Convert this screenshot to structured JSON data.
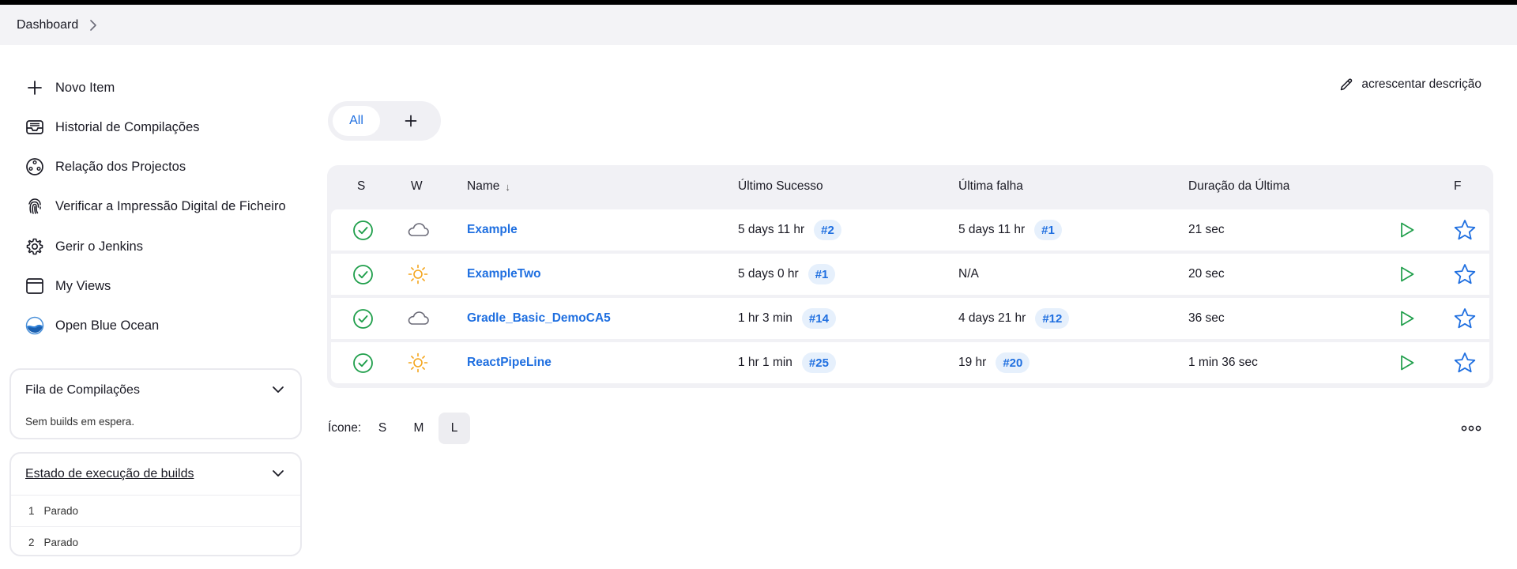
{
  "breadcrumb": {
    "items": [
      "Dashboard"
    ]
  },
  "sidebar": {
    "tasks": [
      {
        "label": "Novo Item",
        "icon": "plus-icon"
      },
      {
        "label": "Historial de Compilações",
        "icon": "inbox-icon"
      },
      {
        "label": "Relação dos Projectos",
        "icon": "relationship-icon"
      },
      {
        "label": "Verificar a Impressão Digital de Ficheiro",
        "icon": "fingerprint-icon"
      },
      {
        "label": "Gerir o Jenkins",
        "icon": "gear-icon"
      },
      {
        "label": "My Views",
        "icon": "window-icon"
      },
      {
        "label": "Open Blue Ocean",
        "icon": "blue-ocean-icon"
      }
    ],
    "build_queue": {
      "title": "Fila de Compilações",
      "empty_text": "Sem builds em espera."
    },
    "executors": {
      "title": "Estado de execução de builds",
      "rows": [
        {
          "num": "1",
          "status": "Parado"
        },
        {
          "num": "2",
          "status": "Parado"
        }
      ]
    }
  },
  "main": {
    "add_description": "acrescentar descrição",
    "tabs": {
      "all": "All",
      "add": "+"
    },
    "table": {
      "headers": {
        "s": "S",
        "w": "W",
        "name": "Name",
        "sort_indicator": "↓",
        "last_success": "Último Sucesso",
        "last_failure": "Última falha",
        "last_duration": "Duração da Última",
        "f": "F"
      },
      "rows": [
        {
          "status": "success",
          "weather": "cloudy",
          "name": "Example",
          "last_success": "5 days 11 hr",
          "success_build": "#2",
          "last_failure": "5 days 11 hr",
          "failure_build": "#1",
          "duration": "21 sec"
        },
        {
          "status": "success",
          "weather": "sunny",
          "name": "ExampleTwo",
          "last_success": "5 days 0 hr",
          "success_build": "#1",
          "last_failure": "N/A",
          "failure_build": "",
          "duration": "20 sec"
        },
        {
          "status": "success",
          "weather": "cloudy",
          "name": "Gradle_Basic_DemoCA5",
          "last_success": "1 hr 3 min",
          "success_build": "#14",
          "last_failure": "4 days 21 hr",
          "failure_build": "#12",
          "duration": "36 sec"
        },
        {
          "status": "success",
          "weather": "sunny",
          "name": "ReactPipeLine",
          "last_success": "1 hr 1 min",
          "success_build": "#25",
          "last_failure": "19 hr",
          "failure_build": "#20",
          "duration": "1 min 36 sec"
        }
      ]
    },
    "icon_size": {
      "label": "Ícone:",
      "options": [
        "S",
        "M",
        "L"
      ],
      "selected": "L"
    }
  },
  "colors": {
    "accent": "#1f6fe0",
    "success": "#1e9e4a",
    "sun": "#f4a51c",
    "cloud": "#6b6b78",
    "badge_bg": "#e6f0fc"
  }
}
